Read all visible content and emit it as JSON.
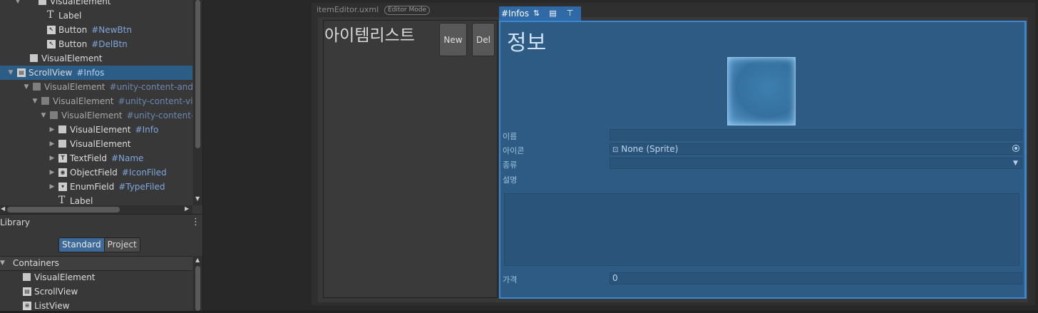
{
  "hierarchy": {
    "rows": [
      {
        "indent": 0,
        "icon": "box",
        "label": "VisualElement",
        "id": "",
        "arrow": "down"
      },
      {
        "indent": 1,
        "icon": "text",
        "label": "Label",
        "id": ""
      },
      {
        "indent": 1,
        "icon": "button",
        "label": "Button",
        "id": "#NewBtn"
      },
      {
        "indent": 1,
        "icon": "button",
        "label": "Button",
        "id": "#DelBtn"
      },
      {
        "indent": 0,
        "icon": "box",
        "label": "VisualElement",
        "id": ""
      },
      {
        "indent": 0,
        "icon": "scroll",
        "label": "ScrollView",
        "id": "#Infos",
        "arrow": "down",
        "selected": true
      },
      {
        "indent": 1,
        "icon": "box",
        "label": "VisualElement",
        "id": "#unity-content-and",
        "arrow": "down",
        "dim": true
      },
      {
        "indent": 2,
        "icon": "box",
        "label": "VisualElement",
        "id": "#unity-content-vi",
        "arrow": "down",
        "dim": true
      },
      {
        "indent": 3,
        "icon": "box",
        "label": "VisualElement",
        "id": "#unity-content-",
        "arrow": "down",
        "dim": true
      },
      {
        "indent": 4,
        "icon": "box",
        "label": "VisualElement",
        "id": "#Info",
        "arrow": "right"
      },
      {
        "indent": 4,
        "icon": "box",
        "label": "VisualElement",
        "id": "",
        "arrow": "right"
      },
      {
        "indent": 4,
        "icon": "textfield",
        "label": "TextField",
        "id": "#Name",
        "arrow": "right"
      },
      {
        "indent": 4,
        "icon": "objectfield",
        "label": "ObjectField",
        "id": "#IconFiled",
        "arrow": "right"
      },
      {
        "indent": 4,
        "icon": "enumfield",
        "label": "EnumField",
        "id": "#TypeFiled",
        "arrow": "right"
      },
      {
        "indent": 4,
        "icon": "text",
        "label": "Label",
        "id": ""
      }
    ]
  },
  "library": {
    "title": "Library",
    "tabs": {
      "standard": "Standard",
      "project": "Project"
    },
    "section": "Containers",
    "items": [
      "VisualElement",
      "ScrollView",
      "ListView"
    ]
  },
  "canvas": {
    "doc_title": "itemEditor.uxml",
    "mode_badge": "Editor Mode",
    "list_title": "아이템리스트",
    "new_button": "New",
    "del_button": "Del",
    "info_tag": "#Infos",
    "info_title": "정보",
    "fields": {
      "name_label": "이름",
      "icon_label": "아이콘",
      "icon_value": "None (Sprite)",
      "type_label": "종류",
      "desc_label": "설명",
      "price_label": "가격",
      "price_value": "0"
    }
  },
  "colors": {
    "selection": "#2c5d87",
    "info_panel": "#2d5b83",
    "info_border": "#3b86cf",
    "id_text": "#7fa6dc"
  }
}
